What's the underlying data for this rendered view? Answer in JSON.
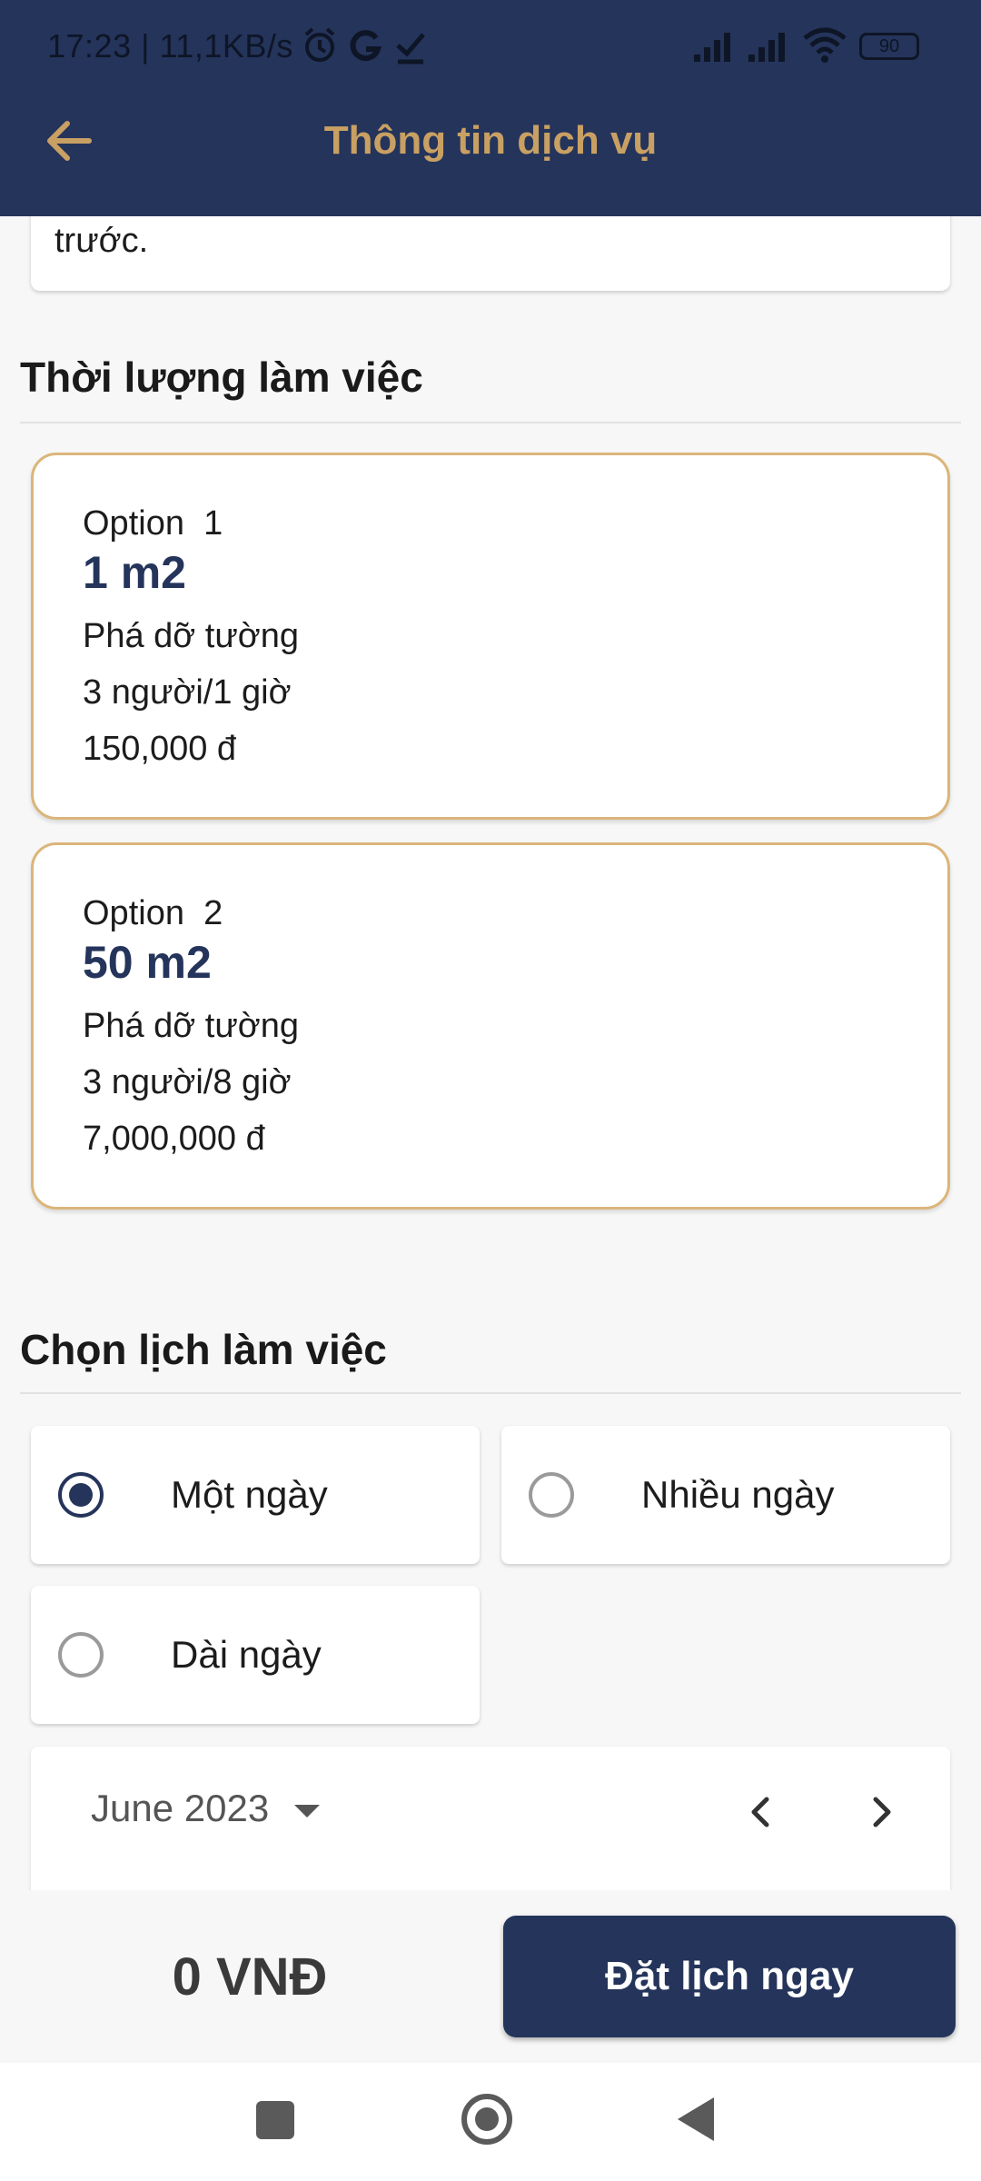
{
  "status_bar": {
    "text": "17:23 | 11,1KB/s",
    "battery": "90"
  },
  "app_bar": {
    "title": "Thông tin dịch vụ"
  },
  "description_tail": "trước.",
  "duration_section": {
    "title": "Thời lượng làm việc",
    "options": [
      {
        "label": "Option  1",
        "area": "1 m2",
        "service": "Phá dỡ tường",
        "staff": "3 người/1 giờ",
        "price": "150,000 đ"
      },
      {
        "label": "Option  2",
        "area": "50 m2",
        "service": "Phá dỡ tường",
        "staff": "3 người/8 giờ",
        "price": "7,000,000 đ"
      }
    ]
  },
  "schedule_section": {
    "title": "Chọn lịch làm việc",
    "choices": [
      {
        "label": "Một ngày",
        "selected": true
      },
      {
        "label": "Nhiều ngày",
        "selected": false
      },
      {
        "label": "Dài ngày",
        "selected": false
      }
    ]
  },
  "calendar": {
    "month": "June 2023"
  },
  "bottom": {
    "total": "0 VNĐ",
    "book_label": "Đặt lịch ngay"
  },
  "colors": {
    "primary": "#24345b",
    "accent": "#c9a063",
    "card_border": "#dcb57a"
  }
}
